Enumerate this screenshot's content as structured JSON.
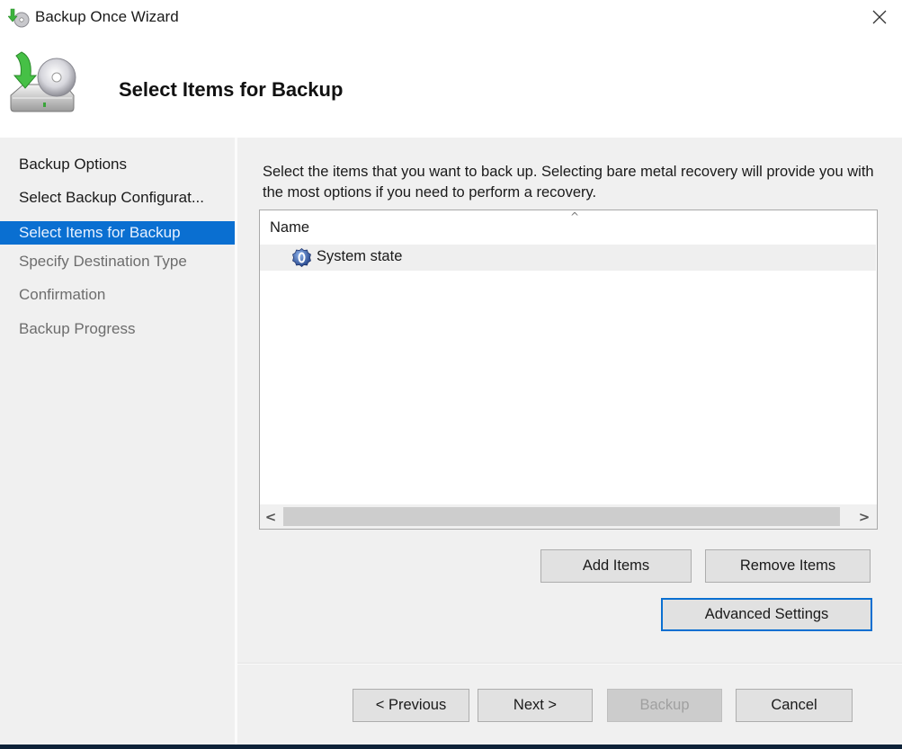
{
  "window": {
    "title": "Backup Once Wizard",
    "app_icon": "backup-wizard-icon",
    "close_icon": "close-icon"
  },
  "header": {
    "title": "Select Items for Backup",
    "icon": "backup-disk-icon"
  },
  "sidebar": {
    "items": [
      {
        "label": "Backup Options",
        "state": "done"
      },
      {
        "label": "Select Backup Configurat...",
        "state": "done"
      },
      {
        "label": "Select Items for Backup",
        "state": "active"
      },
      {
        "label": "Specify Destination Type",
        "state": "pending"
      },
      {
        "label": "Confirmation",
        "state": "pending"
      },
      {
        "label": "Backup Progress",
        "state": "pending"
      }
    ]
  },
  "main": {
    "description": "Select the items that you want to back up. Selecting bare metal recovery will provide you with the most options if you need to perform a recovery.",
    "list": {
      "column_header": "Name",
      "sort_indicator": "^",
      "items": [
        {
          "label": "System state",
          "icon": "system-state-icon"
        }
      ],
      "scroll_left": "<",
      "scroll_right": ">"
    },
    "buttons": {
      "add_items": "Add Items",
      "remove_items": "Remove Items",
      "advanced_settings": "Advanced Settings"
    }
  },
  "footer": {
    "previous": "< Previous",
    "next": "Next >",
    "backup": "Backup",
    "cancel": "Cancel"
  },
  "colors": {
    "accent": "#0a6fd1",
    "background": "#f0f0f0",
    "header_bg": "#ffffff"
  }
}
